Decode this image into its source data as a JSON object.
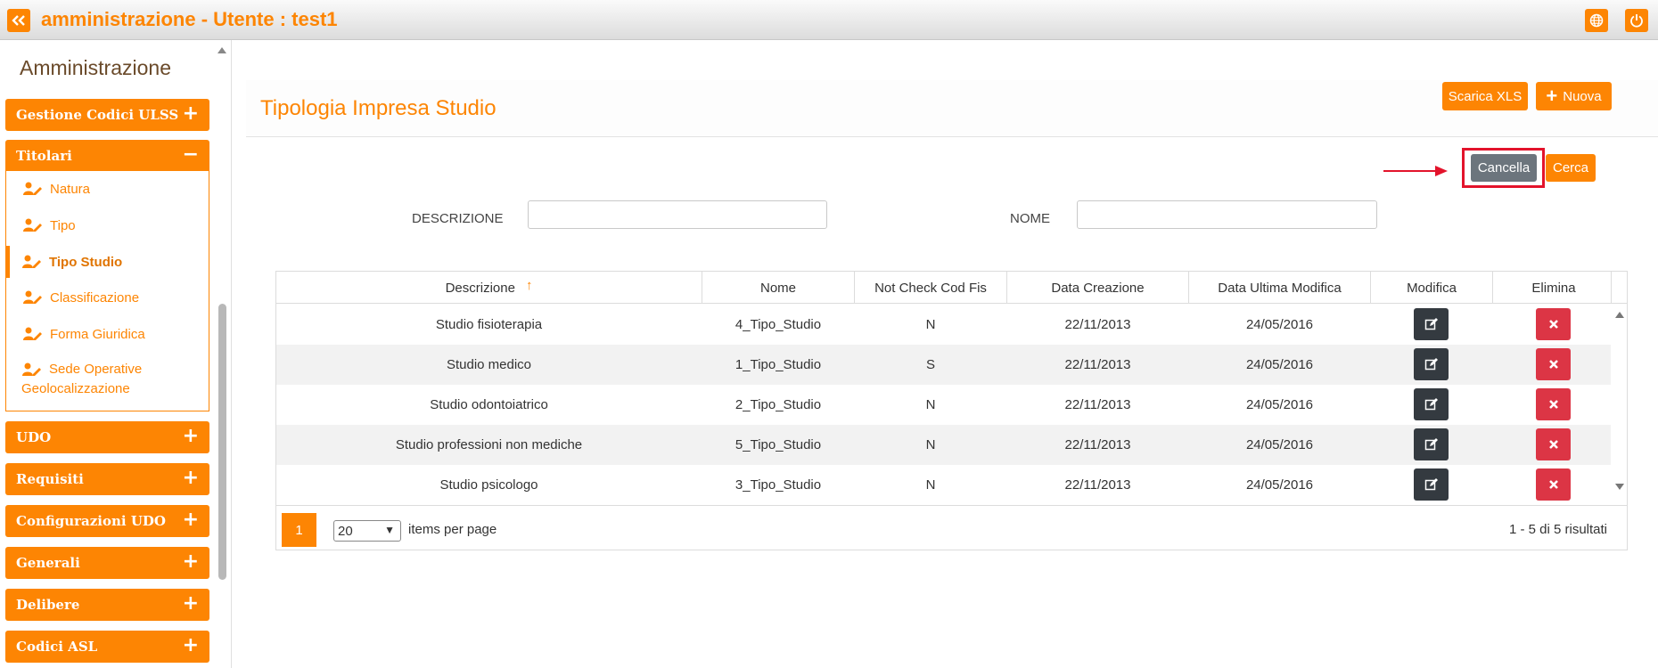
{
  "header": {
    "title": "amministrazione - Utente : test1",
    "colors": {
      "accent": "#fd8503"
    }
  },
  "sidebar": {
    "title": "Amministrazione",
    "sections": [
      {
        "label": "Gestione Codici ULSS",
        "toggle": "+"
      },
      {
        "label": "Titolari",
        "toggle": "−"
      },
      {
        "label": "UDO",
        "toggle": "+"
      },
      {
        "label": "Requisiti",
        "toggle": "+"
      },
      {
        "label": "Configurazioni UDO",
        "toggle": "+"
      },
      {
        "label": "Generali",
        "toggle": "+"
      },
      {
        "label": "Delibere",
        "toggle": "+"
      },
      {
        "label": "Codici ASL",
        "toggle": "+"
      }
    ],
    "titolari_items": [
      {
        "label": "Natura"
      },
      {
        "label": "Tipo"
      },
      {
        "label": "Tipo Studio",
        "active": true
      },
      {
        "label": "Classificazione"
      },
      {
        "label": "Forma Giuridica"
      },
      {
        "label_line1": "Sede Operative",
        "label_line2": "Geolocalizzazione"
      }
    ]
  },
  "main": {
    "title": "Tipologia Impresa Studio",
    "buttons": {
      "download_xls": "Scarica XLS",
      "new": "Nuova",
      "new_icon": "+",
      "clear": "Cancella",
      "search": "Cerca"
    },
    "filters": {
      "descrizione_label": "DESCRIZIONE",
      "descrizione_value": "",
      "nome_label": "NOME",
      "nome_value": ""
    }
  },
  "table": {
    "columns": [
      "Descrizione",
      "Nome",
      "Not Check Cod Fis",
      "Data Creazione",
      "Data Ultima Modifica",
      "Modifica",
      "Elimina"
    ],
    "sort_icon": "↑",
    "rows": [
      {
        "descrizione": "Studio fisioterapia",
        "nome": "4_Tipo_Studio",
        "not_check": "N",
        "creazione": "22/11/2013",
        "modifica": "24/05/2016"
      },
      {
        "descrizione": "Studio medico",
        "nome": "1_Tipo_Studio",
        "not_check": "S",
        "creazione": "22/11/2013",
        "modifica": "24/05/2016"
      },
      {
        "descrizione": "Studio odontoiatrico",
        "nome": "2_Tipo_Studio",
        "not_check": "N",
        "creazione": "22/11/2013",
        "modifica": "24/05/2016"
      },
      {
        "descrizione": "Studio professioni non mediche",
        "nome": "5_Tipo_Studio",
        "not_check": "N",
        "creazione": "22/11/2013",
        "modifica": "24/05/2016"
      },
      {
        "descrizione": "Studio psicologo",
        "nome": "3_Tipo_Studio",
        "not_check": "N",
        "creazione": "22/11/2013",
        "modifica": "24/05/2016"
      }
    ],
    "pager": {
      "page": "1",
      "per_page": "20",
      "per_page_label": "items per page",
      "summary": "1 - 5 di 5 risultati"
    }
  }
}
